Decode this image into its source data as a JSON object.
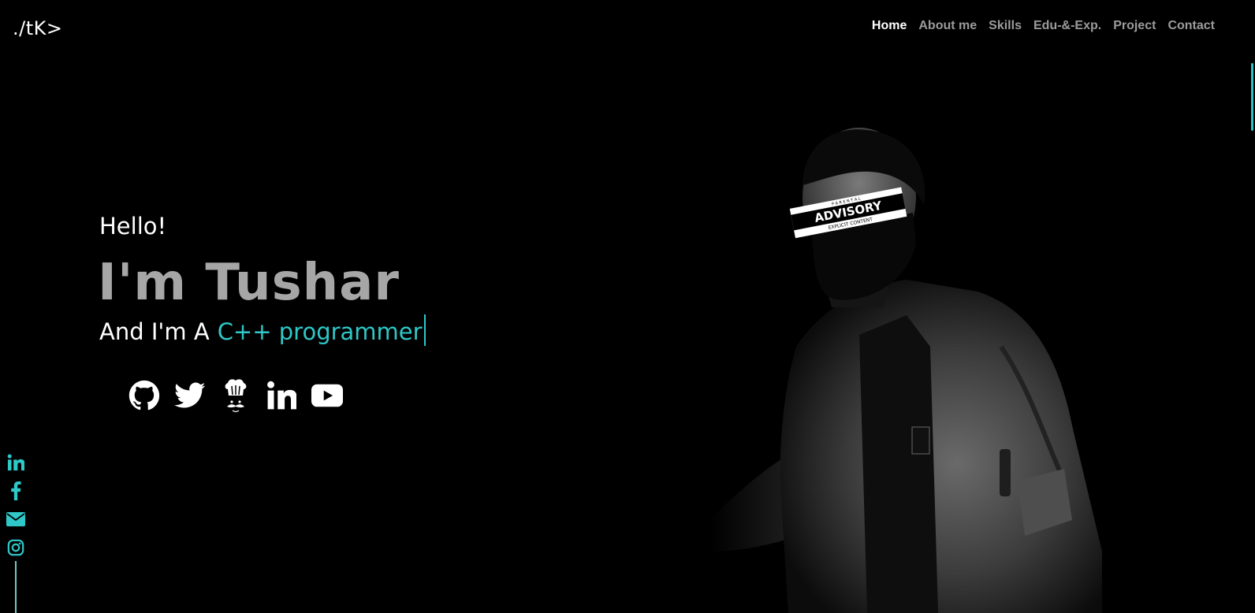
{
  "brand": {
    "logo": "./tK>"
  },
  "nav": {
    "items": [
      {
        "label": "Home",
        "active": true
      },
      {
        "label": "About me"
      },
      {
        "label": "Skills"
      },
      {
        "label": "Edu-&-Exp."
      },
      {
        "label": "Project"
      },
      {
        "label": "Contact"
      }
    ]
  },
  "hero": {
    "greeting": "Hello!",
    "name": "I'm Tushar",
    "prefix": "And I'm A",
    "typed_role": "C++ programmer",
    "socials": [
      "github-icon",
      "twitter-icon",
      "codechef-icon",
      "linkedin-icon",
      "youtube-icon"
    ]
  },
  "sidebar": {
    "socials": [
      "linkedin-icon",
      "facebook-icon",
      "envelope-icon",
      "instagram-icon"
    ]
  },
  "colors": {
    "accent": "#2fc8c8",
    "name_gray": "#a6a6a6",
    "nav_inactive": "#9b9b9b",
    "background": "#000000"
  }
}
